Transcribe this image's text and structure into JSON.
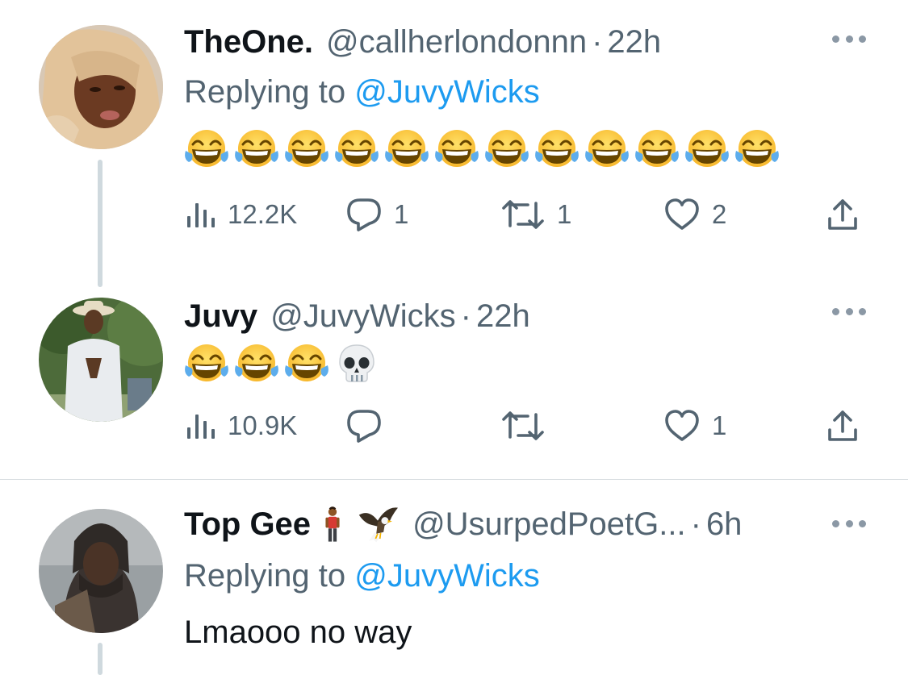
{
  "tweets": [
    {
      "name": "TheOne.",
      "handle": "@callherlondonnn",
      "separator": "·",
      "time": "22h",
      "replying_prefix": "Replying to",
      "replying_to": "@JuvyWicks",
      "emoji": [
        "tears-of-joy-emoji",
        "tears-of-joy-emoji",
        "tears-of-joy-emoji",
        "tears-of-joy-emoji",
        "tears-of-joy-emoji",
        "tears-of-joy-emoji",
        "tears-of-joy-emoji",
        "tears-of-joy-emoji",
        "tears-of-joy-emoji",
        "tears-of-joy-emoji",
        "tears-of-joy-emoji",
        "tears-of-joy-emoji"
      ],
      "views": "12.2K",
      "replies": "1",
      "retweets": "1",
      "likes": "2"
    },
    {
      "name": "Juvy",
      "handle": "@JuvyWicks",
      "separator": "·",
      "time": "22h",
      "emoji": [
        "tears-of-joy-emoji",
        "tears-of-joy-emoji",
        "tears-of-joy-emoji",
        "skull-emoji"
      ],
      "views": "10.9K",
      "replies": "",
      "retweets": "",
      "likes": "1"
    },
    {
      "name": "Top Gee",
      "name_emoji": [
        "man-standing-emoji",
        "eagle-emoji"
      ],
      "handle": "@UsurpedPoetG...",
      "separator": "·",
      "time": "6h",
      "replying_prefix": "Replying to",
      "replying_to": "@JuvyWicks",
      "text": "Lmaooo no way"
    }
  ],
  "colors": {
    "link": "#1d9bf0",
    "secondary_text": "#536471",
    "primary_text": "#0f1419",
    "thread_line": "#cfd9de",
    "divider": "#d8dde1"
  },
  "icons": [
    "views-icon",
    "reply-icon",
    "retweet-icon",
    "like-icon",
    "share-icon",
    "more-icon"
  ]
}
